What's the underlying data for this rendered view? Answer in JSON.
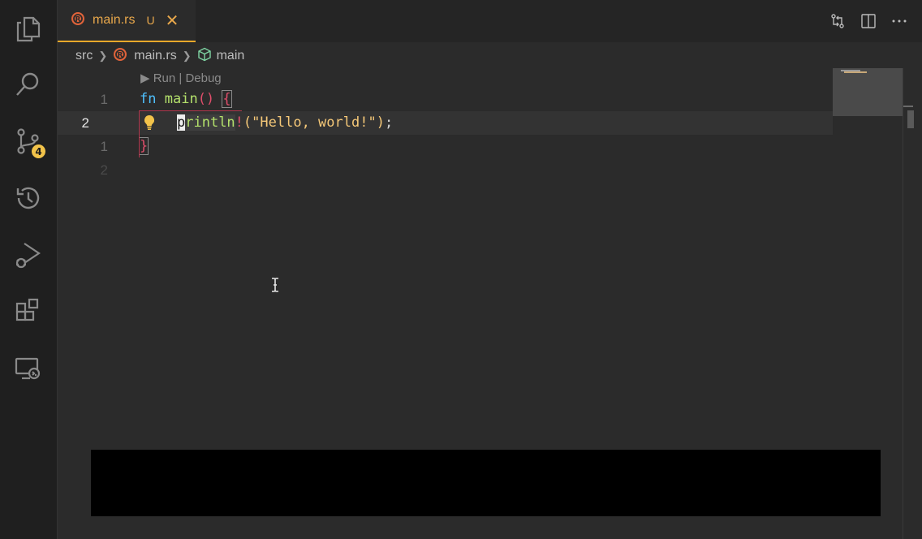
{
  "activity_bar": {
    "items": [
      {
        "name": "explorer-icon"
      },
      {
        "name": "search-icon"
      },
      {
        "name": "source-control-icon",
        "badge": "4"
      },
      {
        "name": "timeline-icon"
      },
      {
        "name": "run-debug-icon"
      },
      {
        "name": "extensions-icon"
      },
      {
        "name": "remote-explorer-icon"
      }
    ]
  },
  "tab": {
    "label": "main.rs",
    "status": "U",
    "close": "✕"
  },
  "breadcrumb": {
    "folder": "src",
    "file": "main.rs",
    "symbol": "main"
  },
  "editor": {
    "codelens": "▶ Run | Debug",
    "lines": [
      {
        "number": "1"
      },
      {
        "number": "2"
      },
      {
        "number": "1"
      },
      {
        "number": "2"
      }
    ],
    "code": {
      "kw_fn": "fn",
      "fn_name": "main",
      "parens": "()",
      "open_brace": "{",
      "cursor_char": "p",
      "macro_rest": "rintln",
      "bang": "!",
      "lparen": "(",
      "string": "\"Hello, world!\"",
      "rparen": ")",
      "semicolon": ";",
      "close_brace": "}"
    }
  },
  "colors": {
    "accent": "#e8a82a",
    "keyword": "#4fc1ff",
    "function": "#b3e06b",
    "string": "#f5c878",
    "paren": "#e04e6b",
    "badge": "#f2c34a"
  }
}
